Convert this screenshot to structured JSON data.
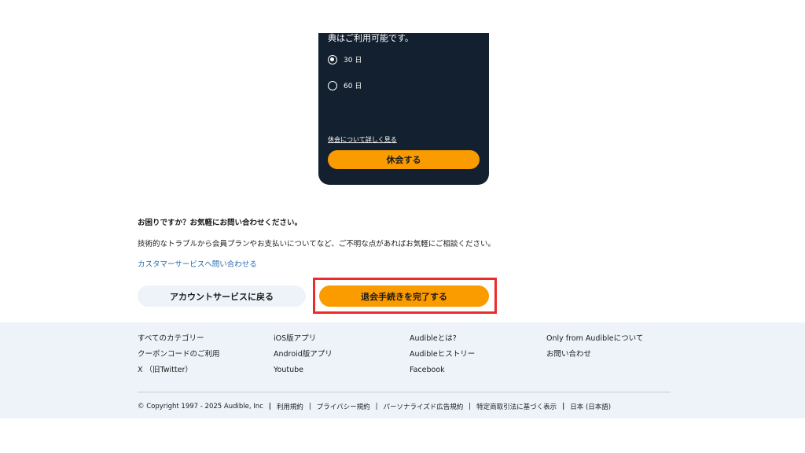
{
  "card": {
    "text_fragment": "典はご利用可能です。",
    "options": [
      {
        "label": "30 日",
        "selected": true
      },
      {
        "label": "60 日",
        "selected": false
      }
    ],
    "learn_more": "休会について詳しく見る",
    "pause_button": "休会する"
  },
  "help": {
    "title": "お困りですか？お気軽にお問い合わせください。",
    "description": "技術的なトラブルから会員プランやお支払いについてなど、ご不明な点があればお気軽にご相談ください。",
    "contact_link": "カスタマーサービスへ問い合わせる"
  },
  "actions": {
    "back_label": "アカウントサービスに戻る",
    "complete_label": "退会手続きを完了する"
  },
  "footer": {
    "columns": [
      [
        "すべてのカテゴリー",
        "クーポンコードのご利用",
        "X （旧Twitter）"
      ],
      [
        "iOS版アプリ",
        "Android版アプリ",
        "Youtube"
      ],
      [
        "Audibleとは?",
        "Audibleヒストリー",
        "Facebook"
      ],
      [
        "Only from Audibleについて",
        "お問い合わせ"
      ]
    ],
    "copyright": "© Copyright 1997 - 2025 Audible, Inc",
    "legal_links": [
      "利用規約",
      "プライバシー規約",
      "パーソナライズド広告規約",
      "特定商取引法に基づく表示",
      "日本 (日本語)"
    ]
  },
  "colors": {
    "card_bg": "#13202f",
    "accent": "#fa9b00",
    "highlight": "#ee2a2a",
    "footer_bg": "#eef3fa",
    "link": "#2b6cb0"
  }
}
